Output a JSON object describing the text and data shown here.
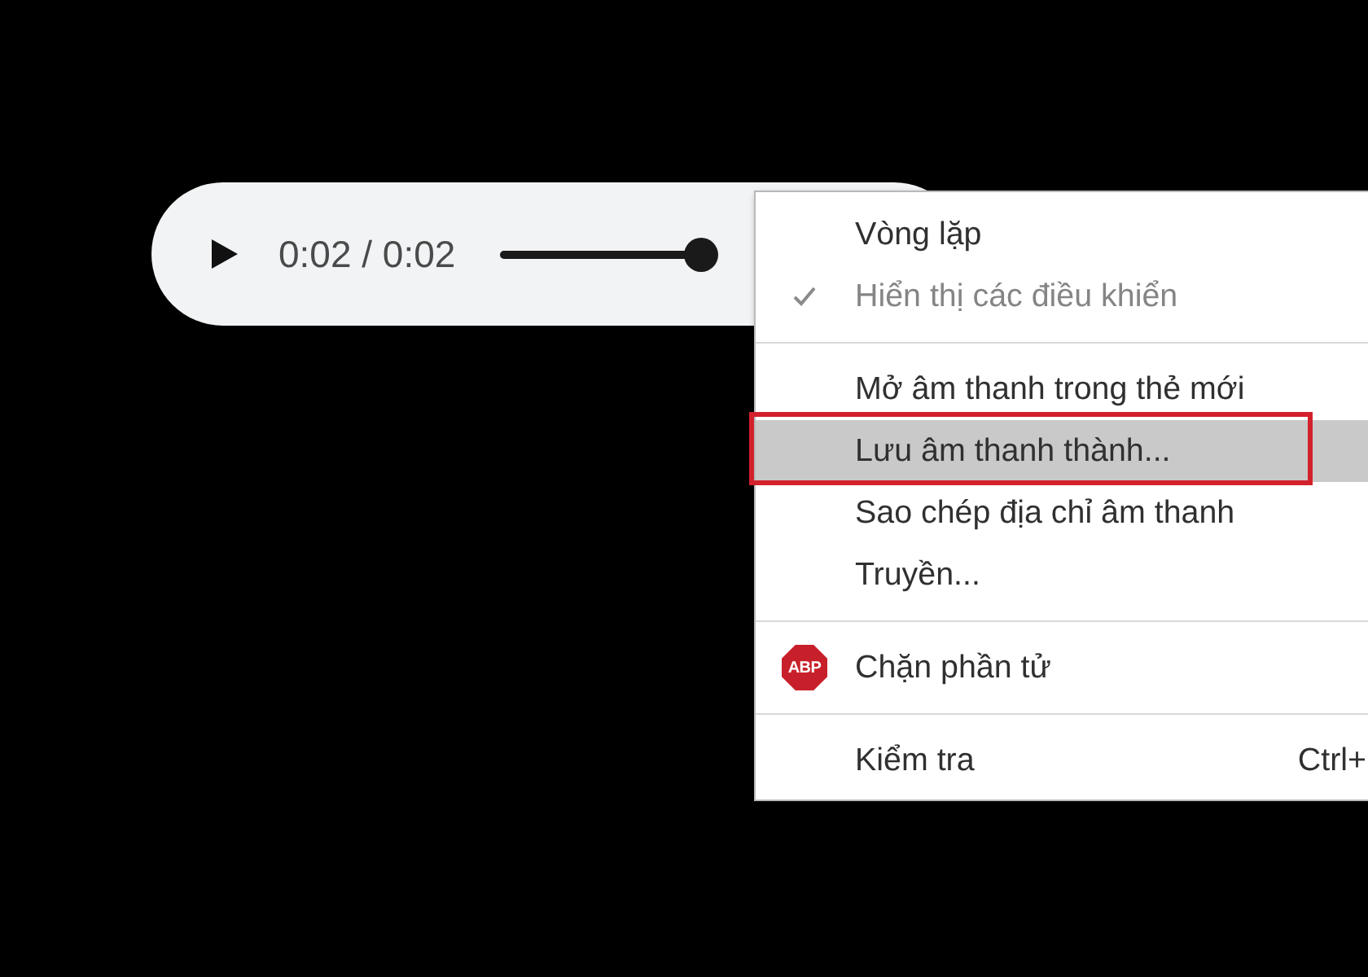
{
  "audio_player": {
    "playing": false,
    "time": "0:02 / 0:02",
    "progress": {
      "level": 1.0
    }
  },
  "context_menu": {
    "items": [
      {
        "kind": "item",
        "label": "Vòng lặp",
        "checked": false,
        "disabled": false,
        "selected": false,
        "outlined": false
      },
      {
        "kind": "item",
        "label": "Hiển thị các điều khiển",
        "checked": true,
        "disabled": true,
        "selected": false,
        "outlined": false
      },
      {
        "kind": "separator"
      },
      {
        "kind": "item",
        "label": "Mở âm thanh trong thẻ mới",
        "checked": false,
        "disabled": false,
        "selected": false,
        "outlined": false
      },
      {
        "kind": "item",
        "label": "Lưu âm thanh thành...",
        "checked": false,
        "disabled": false,
        "selected": true,
        "outlined": true
      },
      {
        "kind": "item",
        "label": "Sao chép địa chỉ âm thanh",
        "checked": false,
        "disabled": false,
        "selected": false,
        "outlined": false
      },
      {
        "kind": "item",
        "label": "Truyền...",
        "checked": false,
        "disabled": false,
        "selected": false,
        "outlined": false
      },
      {
        "kind": "separator"
      },
      {
        "kind": "item",
        "label": "Chặn phần tử",
        "badge": "ABP",
        "checked": false,
        "disabled": false,
        "selected": false,
        "outlined": false
      },
      {
        "kind": "separator"
      },
      {
        "kind": "item",
        "label": "Kiểm tra",
        "shortcut": "Ctrl+",
        "checked": false,
        "disabled": false,
        "selected": false,
        "outlined": false
      }
    ]
  }
}
